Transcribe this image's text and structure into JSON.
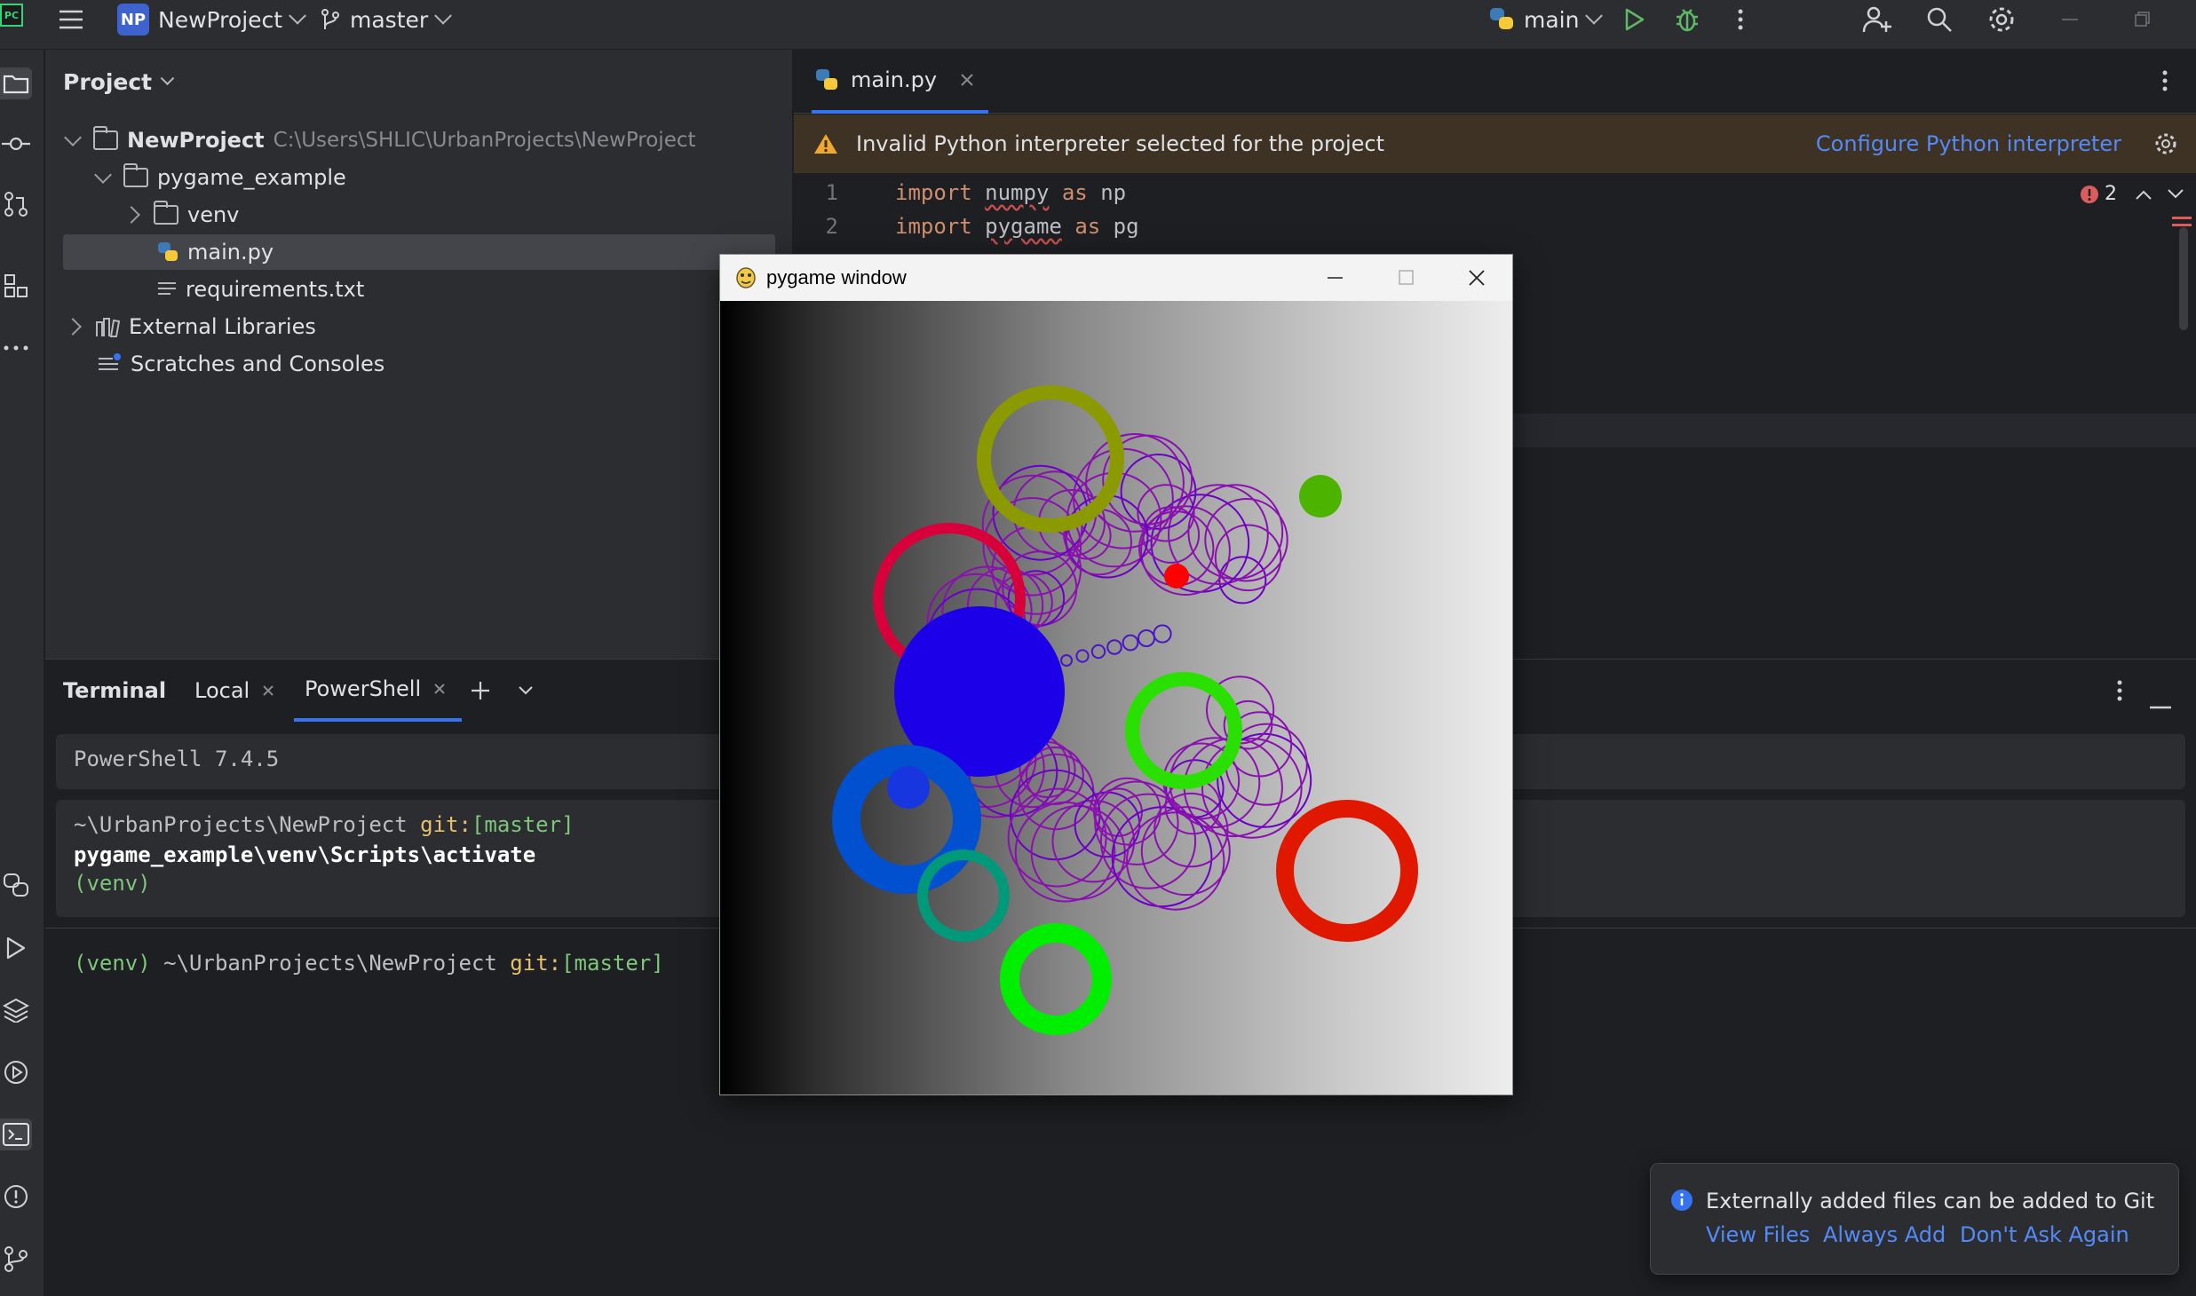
{
  "titlebar": {
    "project_badge": "NP",
    "project_name": "NewProject",
    "branch": "master",
    "run_config": "main",
    "icons": [
      "main-menu-icon",
      "branch-icon",
      "python-icon",
      "run-icon",
      "debug-icon",
      "more-icon",
      "add-user-icon",
      "search-icon",
      "settings-icon",
      "minimize-icon",
      "restore-icon"
    ]
  },
  "left_strip": {
    "icons": [
      "project-folder-icon",
      "commit-icon",
      "pull-requests-icon",
      "structure-icon",
      "more-tools-icon",
      "python-console-icon",
      "run-icon",
      "layers-icon",
      "services-icon",
      "terminal-icon",
      "problems-icon",
      "git-icon"
    ]
  },
  "project_panel": {
    "title": "Project",
    "tree": [
      {
        "label": "NewProject",
        "path": "C:\\Users\\SHLIC\\UrbanProjects\\NewProject"
      },
      {
        "label": "pygame_example"
      },
      {
        "label": "venv"
      },
      {
        "label": "main.py"
      },
      {
        "label": "requirements.txt"
      },
      {
        "label": "External Libraries"
      },
      {
        "label": "Scratches and Consoles"
      }
    ]
  },
  "editor": {
    "tab": "main.py",
    "banner_text": "Invalid Python interpreter selected for the project",
    "banner_link": "Configure Python interpreter",
    "error_count": "2",
    "lines": [
      {
        "num": "1",
        "kw1": "import",
        "mod": "numpy",
        "kw2": "as",
        "alias": "np"
      },
      {
        "num": "2",
        "kw1": "import",
        "mod": "pygame",
        "kw2": "as",
        "alias": "pg"
      }
    ]
  },
  "terminal": {
    "title": "Terminal",
    "tabs": [
      "Local",
      "PowerShell"
    ],
    "version_line": "PowerShell 7.4.5",
    "block_prompt_path": "~\\UrbanProjects\\NewProject",
    "git_label": "git:",
    "git_branch": "[master]",
    "command": "pygame_example\\venv\\Scripts\\activate",
    "venv_output": "(venv)",
    "prompt_venv": "(venv)",
    "prompt_path": "~\\UrbanProjects\\NewProject"
  },
  "pygame_window": {
    "title": "pygame window"
  },
  "notification": {
    "message": "Externally added files can be added to Git",
    "actions": [
      "View Files",
      "Always Add",
      "Don't Ask Again"
    ]
  },
  "colors": {
    "accent": "#3574f0",
    "link": "#548af7",
    "warning": "#f0a732",
    "error": "#db5c5c",
    "run_green": "#5fb865"
  }
}
